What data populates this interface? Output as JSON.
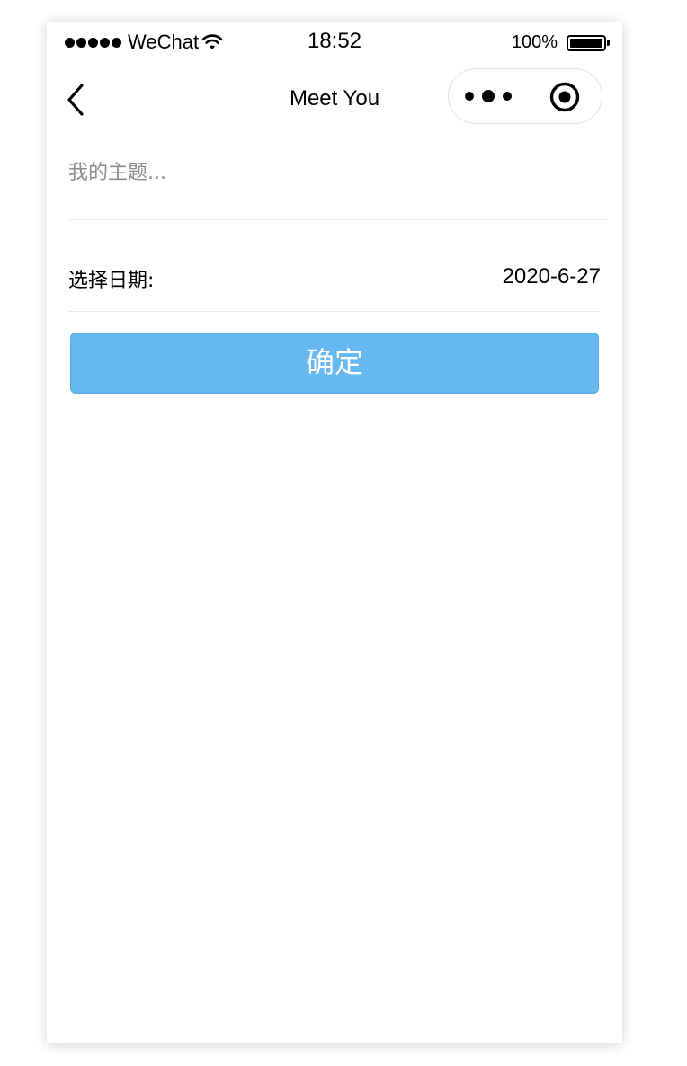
{
  "status_bar": {
    "carrier": "WeChat",
    "time": "18:52",
    "battery_percent": "100%",
    "battery_level": 1.0,
    "signal_bars": 5
  },
  "nav": {
    "title": "Meet You",
    "back_icon": "chevron-left-icon",
    "more_icon": "more-dots-icon",
    "close_icon": "target-circle-icon"
  },
  "form": {
    "topic_placeholder": "我的主题...",
    "topic_value": "",
    "date_label": "选择日期:",
    "date_value": "2020-6-27",
    "confirm_label": "确定"
  },
  "colors": {
    "confirm_bg": "#66b9f0",
    "confirm_text": "#ffffff",
    "placeholder": "#8c8c8c",
    "divider": "#ebebeb"
  }
}
